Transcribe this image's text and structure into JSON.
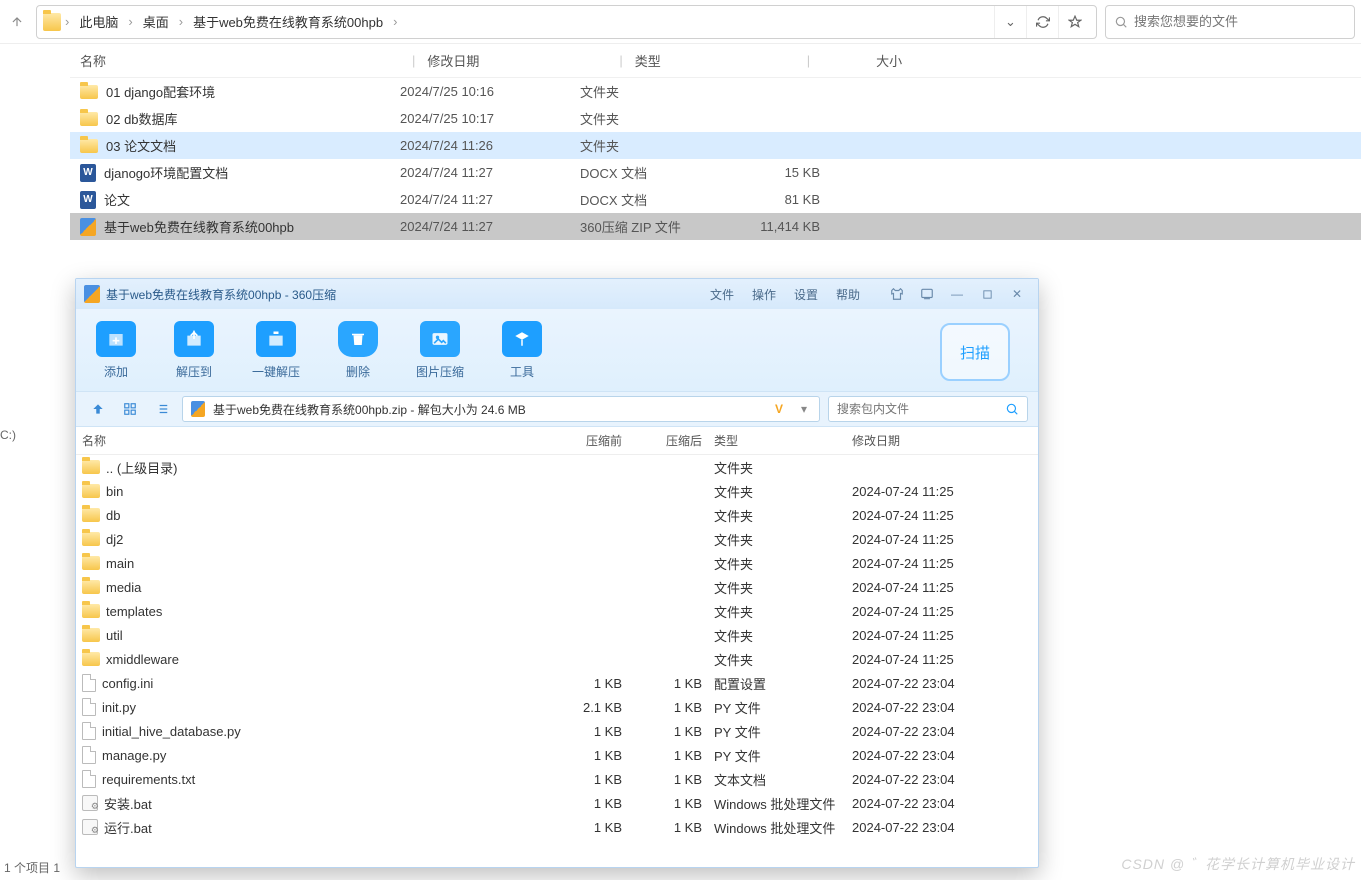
{
  "explorer": {
    "breadcrumbs": [
      "此电脑",
      "桌面",
      "基于web免费在线教育系统00hpb"
    ],
    "search_placeholder": "搜索您想要的文件",
    "columns": {
      "name": "名称",
      "date": "修改日期",
      "type": "类型",
      "size": "大小"
    },
    "rows": [
      {
        "icon": "folder",
        "name": "01 django配套环境",
        "date": "2024/7/25 10:16",
        "type": "文件夹",
        "size": "",
        "state": ""
      },
      {
        "icon": "folder",
        "name": "02 db数据库",
        "date": "2024/7/25 10:17",
        "type": "文件夹",
        "size": "",
        "state": ""
      },
      {
        "icon": "folder",
        "name": "03 论文文档",
        "date": "2024/7/24 11:26",
        "type": "文件夹",
        "size": "",
        "state": "highlight"
      },
      {
        "icon": "docx",
        "name": "djanogo环境配置文档",
        "date": "2024/7/24 11:27",
        "type": "DOCX 文档",
        "size": "15 KB",
        "state": ""
      },
      {
        "icon": "docx",
        "name": "论文",
        "date": "2024/7/24 11:27",
        "type": "DOCX 文档",
        "size": "81 KB",
        "state": ""
      },
      {
        "icon": "zip",
        "name": "基于web免费在线教育系统00hpb",
        "date": "2024/7/24 11:27",
        "type": "360压缩 ZIP 文件",
        "size": "11,414 KB",
        "state": "selected"
      }
    ],
    "status": "1 个项目  1",
    "left_drive": "C:)"
  },
  "zip": {
    "title": "基于web免费在线教育系统00hpb - 360压缩",
    "menus": [
      "文件",
      "操作",
      "设置",
      "帮助"
    ],
    "toolbar": [
      "添加",
      "解压到",
      "一键解压",
      "删除",
      "图片压缩",
      "工具"
    ],
    "scan_label": "扫描",
    "path_label": "基于web免费在线教育系统00hpb.zip - 解包大小为 24.6 MB",
    "vip_mark": "V",
    "search_placeholder": "搜索包内文件",
    "columns": {
      "name": "名称",
      "before": "压缩前",
      "after": "压缩后",
      "type": "类型",
      "date": "修改日期"
    },
    "rows": [
      {
        "icon": "folder",
        "name": ".. (上级目录)",
        "before": "",
        "after": "",
        "type": "文件夹",
        "date": ""
      },
      {
        "icon": "folder",
        "name": "bin",
        "before": "",
        "after": "",
        "type": "文件夹",
        "date": "2024-07-24 11:25"
      },
      {
        "icon": "folder",
        "name": "db",
        "before": "",
        "after": "",
        "type": "文件夹",
        "date": "2024-07-24 11:25"
      },
      {
        "icon": "folder",
        "name": "dj2",
        "before": "",
        "after": "",
        "type": "文件夹",
        "date": "2024-07-24 11:25"
      },
      {
        "icon": "folder",
        "name": "main",
        "before": "",
        "after": "",
        "type": "文件夹",
        "date": "2024-07-24 11:25"
      },
      {
        "icon": "folder",
        "name": "media",
        "before": "",
        "after": "",
        "type": "文件夹",
        "date": "2024-07-24 11:25"
      },
      {
        "icon": "folder",
        "name": "templates",
        "before": "",
        "after": "",
        "type": "文件夹",
        "date": "2024-07-24 11:25"
      },
      {
        "icon": "folder",
        "name": "util",
        "before": "",
        "after": "",
        "type": "文件夹",
        "date": "2024-07-24 11:25"
      },
      {
        "icon": "folder",
        "name": "xmiddleware",
        "before": "",
        "after": "",
        "type": "文件夹",
        "date": "2024-07-24 11:25"
      },
      {
        "icon": "file",
        "name": "config.ini",
        "before": "1 KB",
        "after": "1 KB",
        "type": "配置设置",
        "date": "2024-07-22 23:04"
      },
      {
        "icon": "file",
        "name": "init.py",
        "before": "2.1 KB",
        "after": "1 KB",
        "type": "PY 文件",
        "date": "2024-07-22 23:04"
      },
      {
        "icon": "file",
        "name": "initial_hive_database.py",
        "before": "1 KB",
        "after": "1 KB",
        "type": "PY 文件",
        "date": "2024-07-22 23:04"
      },
      {
        "icon": "file",
        "name": "manage.py",
        "before": "1 KB",
        "after": "1 KB",
        "type": "PY 文件",
        "date": "2024-07-22 23:04"
      },
      {
        "icon": "file",
        "name": "requirements.txt",
        "before": "1 KB",
        "after": "1 KB",
        "type": "文本文档",
        "date": "2024-07-22 23:04"
      },
      {
        "icon": "bat",
        "name": "安装.bat",
        "before": "1 KB",
        "after": "1 KB",
        "type": "Windows 批处理文件",
        "date": "2024-07-22 23:04"
      },
      {
        "icon": "bat",
        "name": "运行.bat",
        "before": "1 KB",
        "after": "1 KB",
        "type": "Windows 批处理文件",
        "date": "2024-07-22 23:04"
      }
    ]
  },
  "watermark": "CSDN @ ゛花学长计算机毕业设计"
}
